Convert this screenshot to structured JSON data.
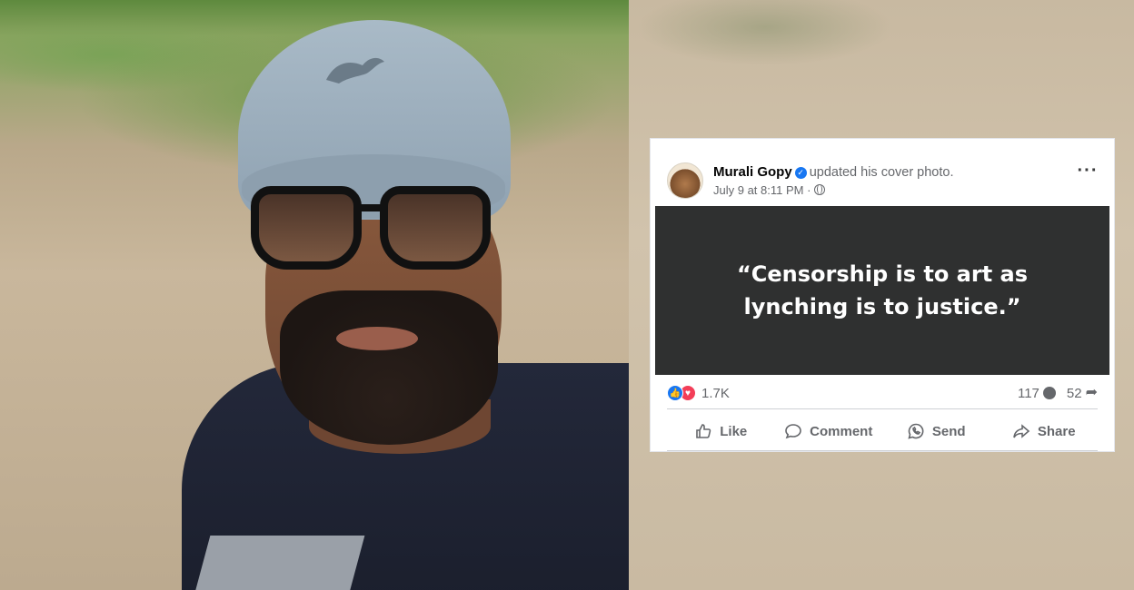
{
  "post": {
    "author": "Murali Gopy",
    "action_text": "updated his cover photo.",
    "timestamp": "July 9 at 8:11 PM",
    "separator": "·",
    "more_icon": "···",
    "quote": "“Censorship is to art as lynching is to justice.”",
    "reaction_count": "1.7K",
    "comment_count": "117",
    "share_count": "52"
  },
  "actions": {
    "like": "Like",
    "comment": "Comment",
    "send": "Send",
    "share": "Share"
  },
  "icons": {
    "verified": "verified-badge-icon",
    "privacy": "globe-icon",
    "like_reaction": "thumbs-up-icon",
    "love_reaction": "heart-icon"
  },
  "colors": {
    "facebook_blue": "#1877f2",
    "love_red": "#f33e58",
    "quote_bg": "#2f3030",
    "meta_gray": "#65676b"
  }
}
